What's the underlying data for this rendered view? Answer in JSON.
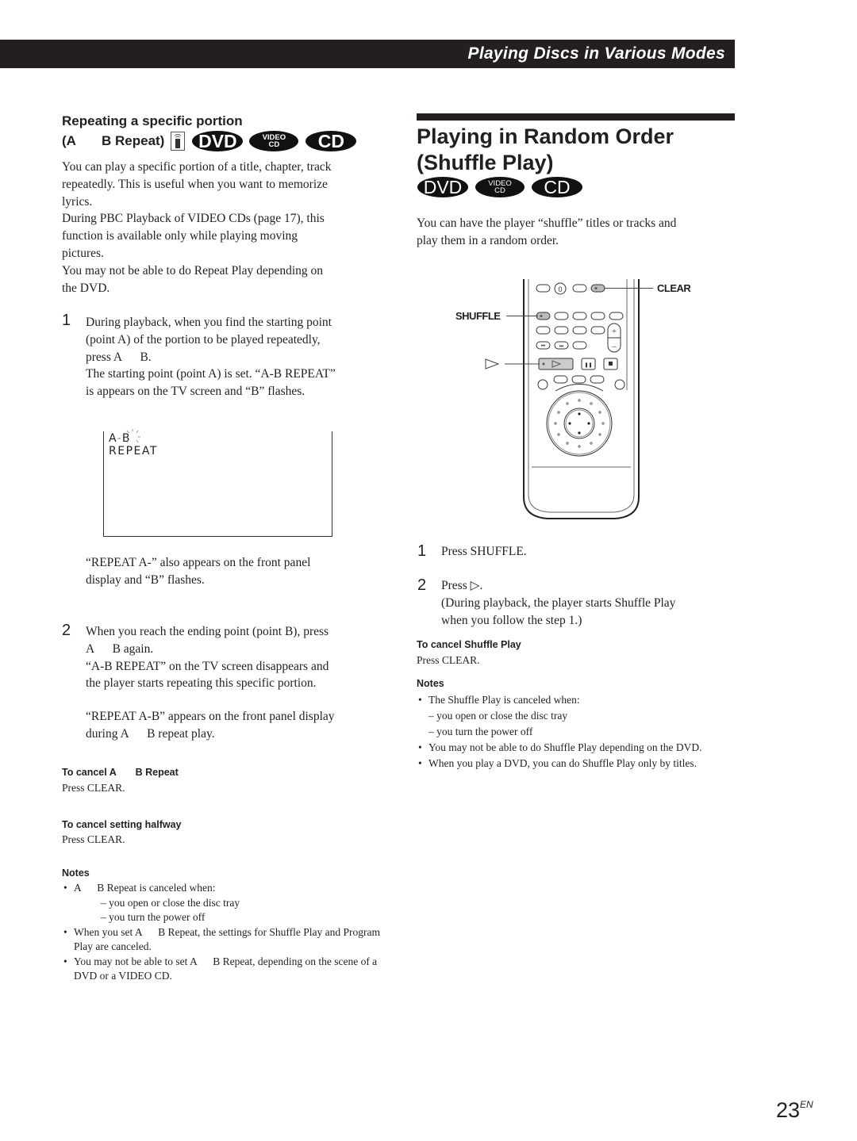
{
  "header": {
    "title": "Playing Discs in Various Modes"
  },
  "left": {
    "heading_line1": "Repeating a specific portion",
    "heading_line2_a": "(A",
    "heading_line2_b": "B Repeat)",
    "icons": [
      "remote-icon"
    ],
    "badges": {
      "dvd": "DVD",
      "vcd_top": "VIDEO",
      "vcd_bottom": "CD",
      "cd": "CD"
    },
    "intro": [
      "You can play a specific portion of a title, chapter, track",
      "repeatedly. This is useful when you want to memorize",
      "lyrics.",
      "During PBC Playback of VIDEO CDs (page 17), this",
      "function is available only while playing moving",
      "pictures.",
      "You may not be able to do Repeat Play depending on",
      "the DVD."
    ],
    "step1": {
      "num": "1",
      "lines": [
        "During playback, when you find the starting point",
        "(point A) of the portion to be played repeatedly,",
        "press A      B.",
        "The starting point (point A) is set.  “A-B REPEAT”",
        "is appears on the TV screen and  “B” flashes."
      ]
    },
    "tv_screen": {
      "line1_a": "A",
      "line1_sep": "-",
      "line1_b": "B",
      "line2": "REPEAT"
    },
    "step1_after": [
      "“REPEAT A-” also appears on the front panel",
      "display and “B” flashes."
    ],
    "step2": {
      "num": "2",
      "lines": [
        "When you reach the ending point (point B), press",
        "A      B again.",
        "“A-B REPEAT” on the TV screen disappears and",
        "the player starts repeating this specific portion."
      ],
      "after": [
        "“REPEAT A-B” appears on the front panel display",
        "during A      B repeat play."
      ]
    },
    "cancel_ab": {
      "title": "To cancel A       B Repeat",
      "text": "Press CLEAR."
    },
    "cancel_halfway": {
      "title": "To cancel setting halfway",
      "text": "Press CLEAR."
    },
    "notes": {
      "title": "Notes",
      "items": [
        {
          "text": "A      B Repeat is canceled when:",
          "sub": [
            "– you open or close the disc tray",
            "– you turn the power off"
          ]
        },
        {
          "text": "When you set A      B Repeat, the settings for Shuffle Play and Program Play are canceled."
        },
        {
          "text": "You may not be able to set A      B Repeat, depending on the scene of a DVD or a VIDEO CD."
        }
      ]
    }
  },
  "right": {
    "title_line1": "Playing in Random Order",
    "title_line2": "(Shuffle Play)",
    "badges": {
      "dvd": "DVD",
      "vcd_top": "VIDEO",
      "vcd_bottom": "CD",
      "cd": "CD"
    },
    "intro": [
      "You can have the player “shuffle” titles or tracks and",
      "play them in a random order."
    ],
    "remote": {
      "label_clear": "CLEAR",
      "label_shuffle": "SHUFFLE",
      "label_play": "▷",
      "zero_key": "0"
    },
    "step1": {
      "num": "1",
      "text": "Press SHUFFLE."
    },
    "step2": {
      "num": "2",
      "text": "Press ▷.",
      "lines": [
        "(During playback, the player starts Shuffle Play",
        "when you follow the step 1.)"
      ]
    },
    "cancel": {
      "title": "To cancel Shuffle Play",
      "text": "Press CLEAR."
    },
    "notes": {
      "title": "Notes",
      "items": [
        {
          "text": "The Shuffle Play is canceled when:",
          "sub": [
            "– you open or close the disc tray",
            "– you turn the power off"
          ]
        },
        {
          "text": "You may not be able to do Shuffle Play depending on the DVD."
        },
        {
          "text": "When you play a DVD, you can do Shuffle Play only by titles."
        }
      ]
    }
  },
  "footer": {
    "page": "23",
    "suffix": "EN"
  }
}
